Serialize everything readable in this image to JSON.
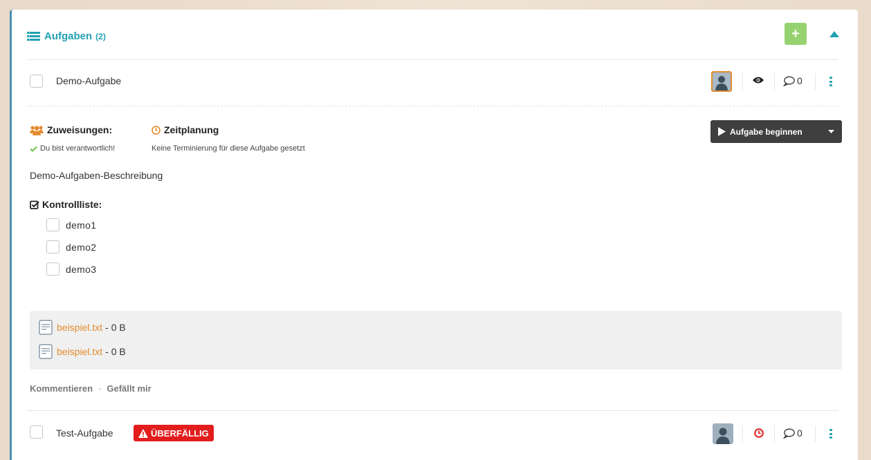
{
  "header": {
    "title": "Aufgaben",
    "count": "(2)",
    "accent_color": "#21a1b3",
    "add_icon": "plus-icon",
    "collapse_icon": "caret-up-icon"
  },
  "tasks": [
    {
      "title": "Demo-Aufgabe",
      "comment_count": "0",
      "icons": [
        "avatar",
        "eye-icon",
        "comment-icon",
        "kebab-menu-icon"
      ]
    },
    {
      "title": "Test-Aufgabe",
      "badge": "ÜBERFÄLLIG",
      "badge_color": "#e31c1c",
      "comment_count": "0",
      "icons": [
        "avatar",
        "clock-icon",
        "comment-icon",
        "kebab-menu-icon"
      ]
    }
  ],
  "details": {
    "assignments_label": "Zuweisungen:",
    "assignments_text": "Du bist verantwortlich!",
    "schedule_label": "Zeitplanung",
    "schedule_text": "Keine Terminierung für diese Aufgabe gesetzt",
    "start_button": "Aufgabe beginnen",
    "description": "Demo-Aufgaben-Beschreibung",
    "checklist_label": "Kontrollliste:",
    "checklist": [
      "demo1",
      "demo2",
      "demo3"
    ],
    "files": [
      {
        "name": "beispiel.txt",
        "size": "- 0 B"
      },
      {
        "name": "beispiel.txt",
        "size": "- 0 B"
      }
    ],
    "comment_action": "Kommentieren",
    "separator": "·",
    "like_action": "Gefällt mir"
  }
}
